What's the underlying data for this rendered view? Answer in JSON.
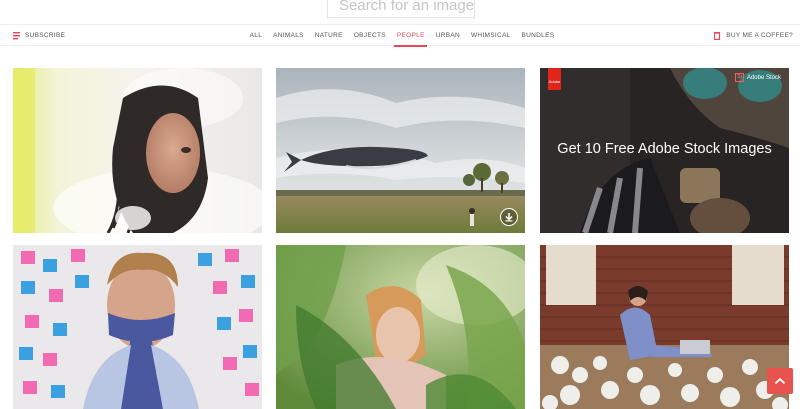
{
  "search": {
    "placeholder": "Search for an image"
  },
  "header": {
    "subscribe_label": "SUBSCRIBE",
    "coffee_label": "BUY ME A COFFEE?"
  },
  "categories": {
    "active": "PEOPLE",
    "items": [
      "ALL",
      "ANIMALS",
      "NATURE",
      "OBJECTS",
      "PEOPLE",
      "URBAN",
      "WHIMSICAL",
      "BUNDLES"
    ]
  },
  "ad": {
    "text": "Get 10 Free Adobe Stock Images",
    "badge_text": "Adobe Stock",
    "badge_code": "St",
    "logo_text": "Adobe"
  },
  "colors": {
    "accent": "#e8455a",
    "to_top_button": "#e8524d"
  },
  "icons": {
    "subscribe": "bookmark-icon",
    "coffee": "coffee-cup-icon",
    "download": "download-icon",
    "back_to_top": "chevron-up-icon"
  }
}
